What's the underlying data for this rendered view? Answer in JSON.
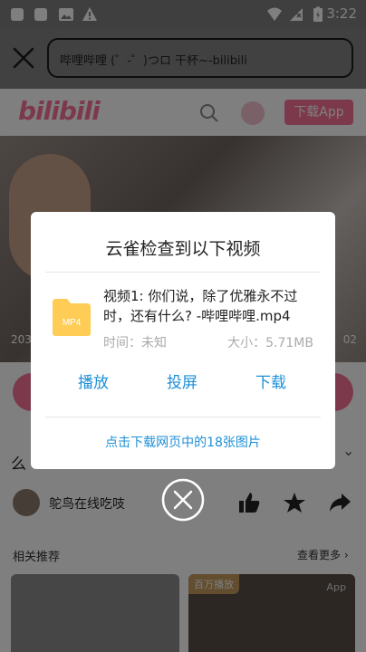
{
  "status_bar": {
    "time": "3:22"
  },
  "browser": {
    "url_text": "哔哩哔哩 (゜-゜)つロ 干杯~-bilibili"
  },
  "site": {
    "logo": "bilibili",
    "download_app": "下载App",
    "video_overlay_left": "203",
    "video_overlay_right": "02"
  },
  "page": {
    "title_fragment": "么",
    "uploader": "鸵鸟在线吃吱",
    "recommend_header": "相关推荐",
    "recommend_more": "查看更多 ›",
    "rec2_badge": "百万播放",
    "rec2_app": "App"
  },
  "dialog": {
    "title": "云雀检查到以下视频",
    "file_label": "MP4",
    "file_name": "视频1: 你们说，除了优雅永不过时，还有什么? -哔哩哔哩.mp4",
    "time_text": "时间：未知",
    "size_text": "大小：5.71MB",
    "btn_play": "播放",
    "btn_cast": "投屏",
    "btn_download": "下载",
    "link_images": "点击下载网页中的18张图片"
  },
  "colors": {
    "accent": "#1e8fd6",
    "brand": "#fb7299",
    "file_yellow": "#ffcc55"
  }
}
